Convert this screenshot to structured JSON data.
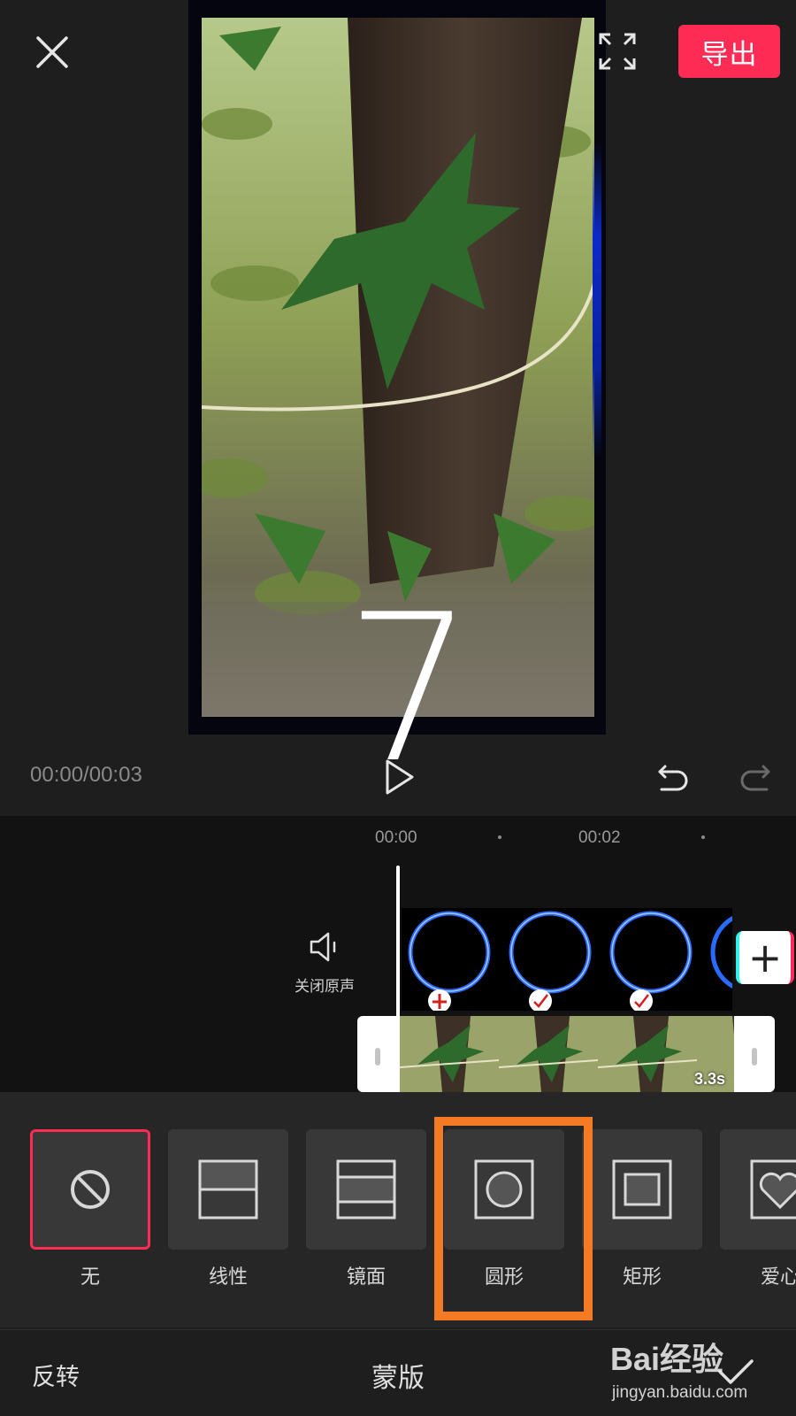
{
  "header": {
    "close_icon": "close-icon",
    "fullscreen_icon": "fullscreen-icon",
    "export_label": "导出"
  },
  "preview": {
    "overlay_text": "7",
    "timecode": "00:00/00:03",
    "play_icon": "play-icon",
    "undo_icon": "undo-icon",
    "redo_icon": "redo-icon"
  },
  "timeline": {
    "ruler_labels": [
      "00:00",
      "00:02"
    ],
    "mute_label": "关闭原声",
    "add_icon": "+",
    "main_clip_duration": "3.3s"
  },
  "mask_panel": {
    "options": [
      {
        "label": "无",
        "icon": "none-icon",
        "selected": true
      },
      {
        "label": "线性",
        "icon": "linear-mask-icon",
        "selected": false
      },
      {
        "label": "镜面",
        "icon": "mirror-mask-icon",
        "selected": false
      },
      {
        "label": "圆形",
        "icon": "circle-mask-icon",
        "selected": false
      },
      {
        "label": "矩形",
        "icon": "rectangle-mask-icon",
        "selected": false
      },
      {
        "label": "爱心",
        "icon": "heart-mask-icon",
        "selected": false
      }
    ]
  },
  "bottom_bar": {
    "invert_label": "反转",
    "title": "蒙版",
    "confirm_icon": "check-icon"
  },
  "watermark": {
    "brand": "Bai经验",
    "url": "jingyan.baidu.com"
  },
  "colors": {
    "accent": "#fe2c55",
    "highlight": "#f47a23",
    "background": "#1e1e1e"
  }
}
